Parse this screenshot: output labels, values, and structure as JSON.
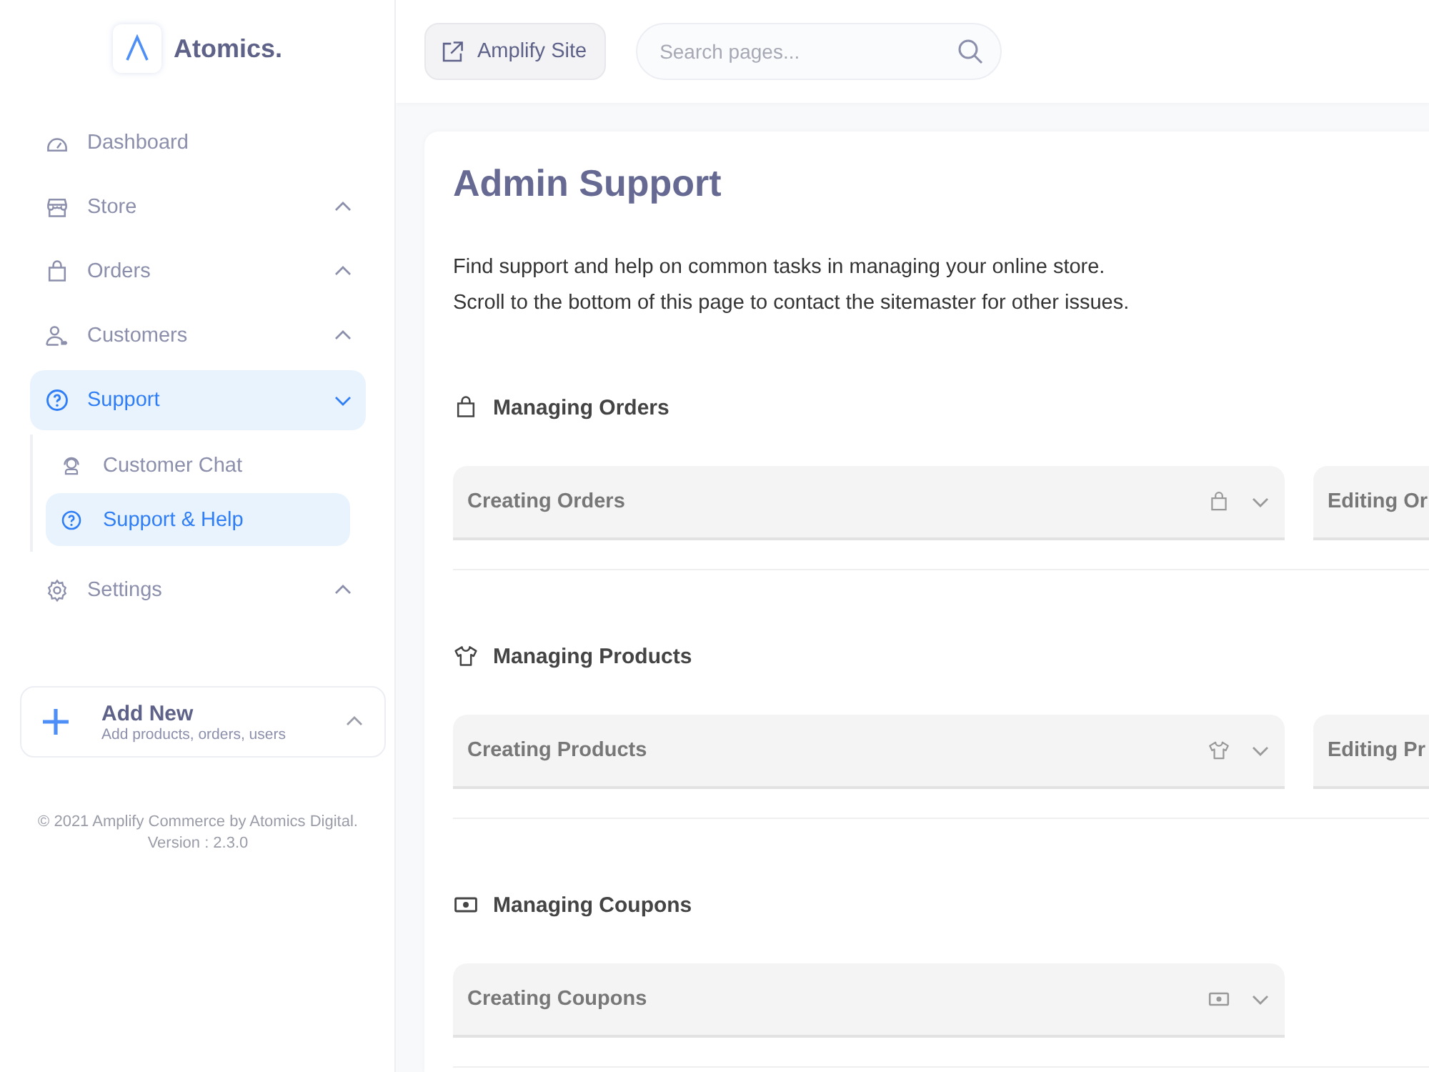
{
  "brand": {
    "name": "Atomics."
  },
  "nav": [
    {
      "kind": "link",
      "label": "Dashboard",
      "selected": false
    },
    {
      "kind": "group",
      "label": "Store",
      "selected": false,
      "expanded": false
    },
    {
      "kind": "group",
      "label": "Orders",
      "selected": false,
      "expanded": false
    },
    {
      "kind": "group",
      "label": "Customers",
      "selected": false,
      "expanded": false
    },
    {
      "kind": "group",
      "label": "Support",
      "selected": true,
      "expanded": true,
      "children": [
        {
          "label": "Customer Chat",
          "selected": false
        },
        {
          "label": "Support & Help",
          "selected": true
        }
      ]
    },
    {
      "kind": "group",
      "label": "Settings",
      "selected": false,
      "expanded": false
    }
  ],
  "add_new": {
    "title": "Add New",
    "subtitle": "Add products, orders, users"
  },
  "footer": {
    "copyright": "© 2021 Amplify Commerce by Atomics Digital.",
    "version": "Version : 2.3.0"
  },
  "topbar": {
    "site_button": "Amplify Site",
    "search": {
      "placeholder": "Search pages..."
    }
  },
  "page": {
    "title": "Admin Support",
    "intro": [
      "Find support and help on common tasks in managing your online store.",
      "Scroll to the bottom of this page to contact the sitemaster for other issues."
    ],
    "sections": [
      {
        "title": "Managing Orders",
        "items": [
          "Creating Orders",
          "Editing Or"
        ]
      },
      {
        "title": "Managing Products",
        "items": [
          "Creating Products",
          "Editing Pr"
        ]
      },
      {
        "title": "Managing Coupons",
        "items": [
          "Creating Coupons"
        ]
      }
    ]
  }
}
